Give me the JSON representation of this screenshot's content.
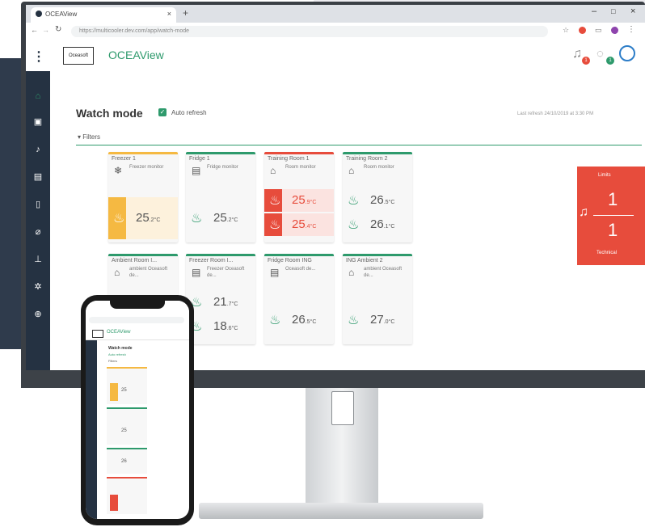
{
  "browser": {
    "tab_title": "OCEAView",
    "url": "https://multicooler.dev.com/app/watch-mode"
  },
  "app": {
    "logo_text": "Oceasoft",
    "title": "OCEAView"
  },
  "page": {
    "title": "Watch mode",
    "auto_refresh_label": "Auto refresh",
    "last_refresh": "Last refresh 24/10/2019 at 3:30 PM",
    "filters_label": "Filters"
  },
  "cards": [
    {
      "name": "Freezer 1",
      "type": "Freezer monitor",
      "icon": "snowflake-icon",
      "accent": "#f5b942",
      "values": [
        {
          "v": "25",
          "d": ".2",
          "u": "°C",
          "alert": "warning"
        }
      ]
    },
    {
      "name": "Fridge 1",
      "type": "Fridge monitor",
      "icon": "fridge-icon",
      "accent": "#2e9a6c",
      "values": [
        {
          "v": "25",
          "d": ".2",
          "u": "°C",
          "alert": "ok"
        }
      ]
    },
    {
      "name": "Training Room 1",
      "type": "Room monitor",
      "icon": "home-icon",
      "accent": "#e74c3c",
      "values": [
        {
          "v": "25",
          "d": ".9",
          "u": "°C",
          "alert": "alarm"
        },
        {
          "v": "25",
          "d": ".4",
          "u": "°C",
          "alert": "alarm"
        }
      ]
    },
    {
      "name": "Training Room 2",
      "type": "Room monitor",
      "icon": "home-icon",
      "accent": "#2e9a6c",
      "values": [
        {
          "v": "26",
          "d": ".5",
          "u": "°C",
          "alert": "ok"
        },
        {
          "v": "26",
          "d": ".1",
          "u": "°C",
          "alert": "ok"
        }
      ]
    },
    {
      "name": "Ambient Room I...",
      "type": "ambient Oceasoft de...",
      "icon": "home-icon",
      "accent": "#2e9a6c",
      "values": []
    },
    {
      "name": "Freezer Room I...",
      "type": "Freezer Oceasoft de...",
      "icon": "fridge-icon",
      "accent": "#2e9a6c",
      "values": [
        {
          "v": "21",
          "d": ".7",
          "u": "°C",
          "alert": "ok"
        },
        {
          "v": "18",
          "d": ".6",
          "u": "°C",
          "alert": "ok"
        }
      ]
    },
    {
      "name": "Fridge Room ING",
      "type": "Oceasoft de...",
      "icon": "fridge-icon",
      "accent": "#2e9a6c",
      "values": [
        {
          "v": "26",
          "d": ".5",
          "u": "°C",
          "alert": "ok"
        }
      ]
    },
    {
      "name": "ING Ambient 2",
      "type": "ambient Oceasoft de...",
      "icon": "home-icon",
      "accent": "#2e9a6c",
      "values": [
        {
          "v": "27",
          "d": ".0",
          "u": "°C",
          "alert": "ok"
        }
      ]
    }
  ],
  "alert_panel": {
    "limits_label": "Limits",
    "limits_count": "1",
    "technical_count": "1",
    "technical_label": "Technical"
  },
  "header_badges": {
    "notifications": "1",
    "messages": "1"
  },
  "phone": {
    "app_title": "OCEAView",
    "page_title": "Watch mode",
    "auto_refresh_label": "Auto refresh",
    "filters_label": "Filters",
    "values": [
      "25",
      "25",
      "26"
    ]
  },
  "colors": {
    "sidebar": "#253242",
    "accent_green": "#2e9a6c",
    "alarm_red": "#e74c3c",
    "warning_yellow": "#f5b942"
  }
}
